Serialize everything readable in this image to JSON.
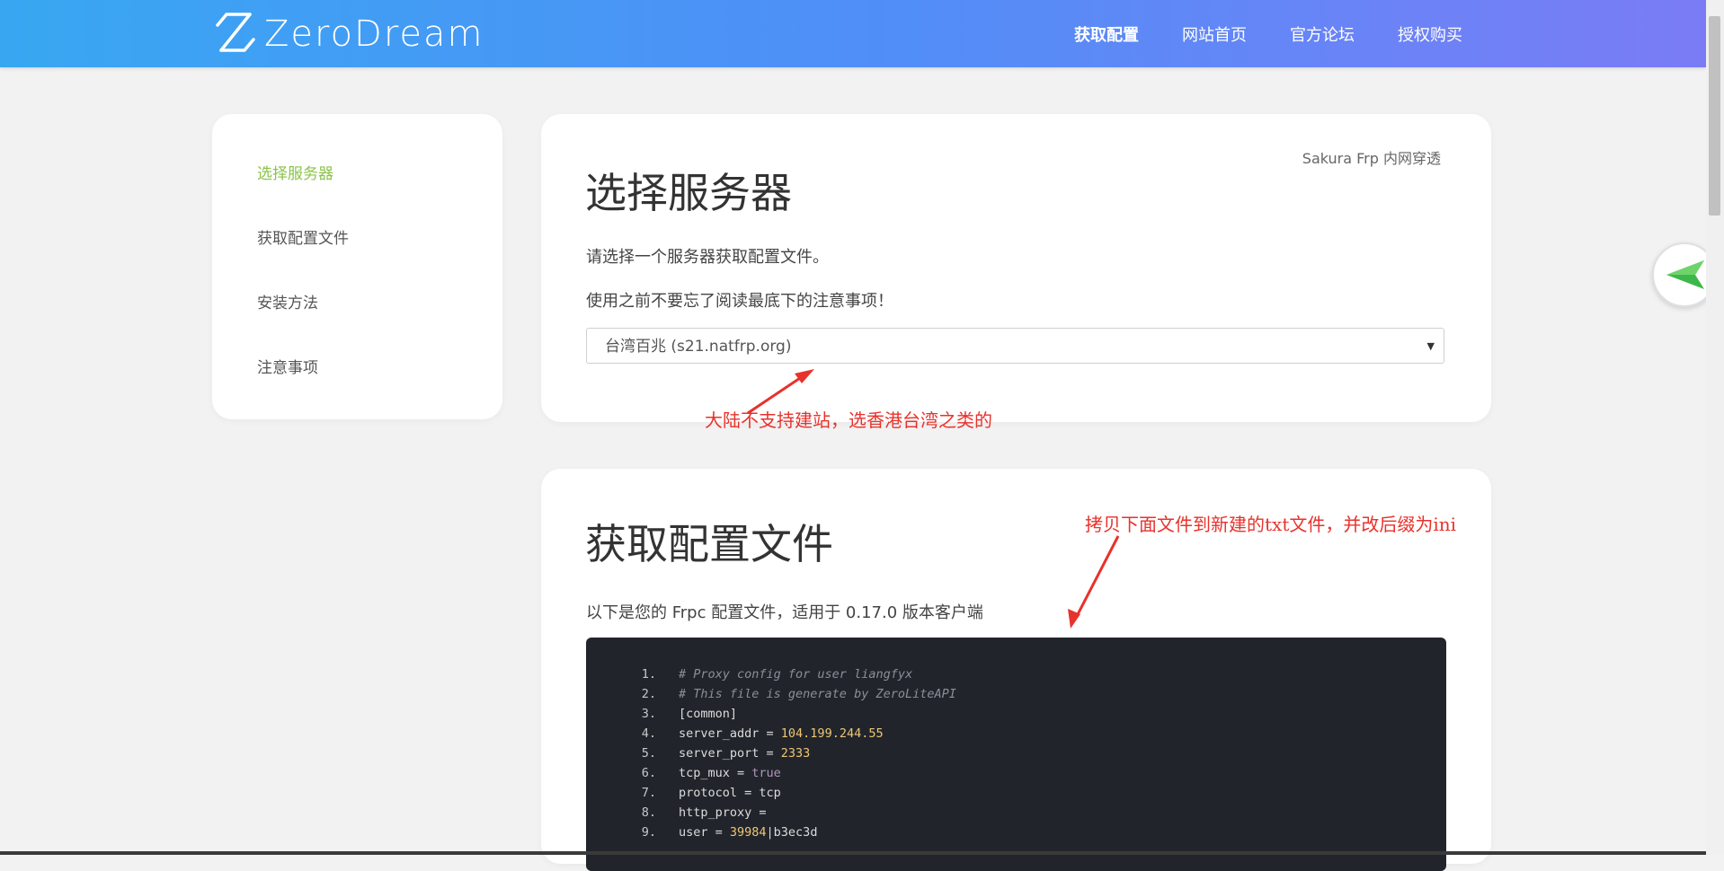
{
  "header": {
    "brand": "ZeroDream",
    "nav": [
      {
        "label": "获取配置",
        "active": true
      },
      {
        "label": "网站首页",
        "active": false
      },
      {
        "label": "官方论坛",
        "active": false
      },
      {
        "label": "授权购买",
        "active": false
      }
    ],
    "gradient": [
      "#38a7f2",
      "#7b7cf5"
    ]
  },
  "sidebar": {
    "items": [
      {
        "label": "选择服务器",
        "active": true
      },
      {
        "label": "获取配置文件",
        "active": false
      },
      {
        "label": "安装方法",
        "active": false
      },
      {
        "label": "注意事项",
        "active": false
      }
    ],
    "active_color": "#8bc34a"
  },
  "server_card": {
    "tag": "Sakura Frp 内网穿透",
    "title": "选择服务器",
    "desc1": "请选择一个服务器获取配置文件。",
    "desc2": "使用之前不要忘了阅读最底下的注意事项！",
    "selected_server": "台湾百兆 (s21.natfrp.org)"
  },
  "config_card": {
    "title": "获取配置文件",
    "desc": "以下是您的 Frpc 配置文件，适用于 0.17.0 版本客户端",
    "code_lines": [
      {
        "n": "1.",
        "parts": [
          {
            "t": "# Proxy config for user liangfyx",
            "c": "comment"
          }
        ]
      },
      {
        "n": "2.",
        "parts": [
          {
            "t": "# This file is generate by ZeroLiteAPI",
            "c": "comment"
          }
        ]
      },
      {
        "n": "3.",
        "parts": [
          {
            "t": "[common]",
            "c": ""
          }
        ]
      },
      {
        "n": "4.",
        "parts": [
          {
            "t": "server_addr = ",
            "c": ""
          },
          {
            "t": "104.199.244.55",
            "c": "num"
          }
        ]
      },
      {
        "n": "5.",
        "parts": [
          {
            "t": "server_port = ",
            "c": ""
          },
          {
            "t": "2333",
            "c": "num"
          }
        ]
      },
      {
        "n": "6.",
        "parts": [
          {
            "t": "tcp_mux = ",
            "c": ""
          },
          {
            "t": "true",
            "c": "kw"
          }
        ]
      },
      {
        "n": "7.",
        "parts": [
          {
            "t": "protocol = tcp",
            "c": ""
          }
        ]
      },
      {
        "n": "8.",
        "parts": [
          {
            "t": "http_proxy =",
            "c": ""
          }
        ]
      },
      {
        "n": "9.",
        "parts": [
          {
            "t": "user = ",
            "c": ""
          },
          {
            "t": "39984",
            "c": "num"
          },
          {
            "t": "|b3ec3d",
            "c": ""
          }
        ]
      }
    ]
  },
  "annotations": {
    "note1": "大陆不支持建站，选香港台湾之类的",
    "note2": "拷贝下面文件到新建的txt文件，并改后缀为ini",
    "color": "#e8322c"
  },
  "icons": {
    "logo": "zerodream-logo-icon",
    "float": "back-arrow-icon",
    "caret": "caret-down-icon"
  }
}
